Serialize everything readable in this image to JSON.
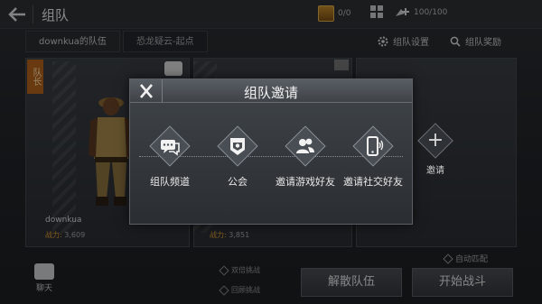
{
  "header": {
    "title": "组队",
    "chest_count": "0/0",
    "energy": "100/100"
  },
  "subbar": {
    "team_name": "downkua的队伍",
    "map_name": "恐龙疑云-起点",
    "settings_label": "组队设置",
    "rewards_label": "组队奖励"
  },
  "members": [
    {
      "badge": "队长",
      "name": "downkua",
      "power_label": "战力:",
      "power": "3,609"
    },
    {
      "power_label": "战力:",
      "power": "3,851"
    }
  ],
  "bottom": {
    "chat_label": "聊天",
    "option1": "双倍挑战",
    "option2": "回顾挑战",
    "auto_match": "自动匹配",
    "dissolve_label": "解散队伍",
    "start_label": "开始战斗"
  },
  "modal": {
    "title": "组队邀请",
    "options": [
      {
        "label": "组队频道",
        "icon": "chat-bubbles-icon"
      },
      {
        "label": "公会",
        "icon": "guild-banner-icon"
      },
      {
        "label": "邀请游戏好友",
        "icon": "friends-icon"
      },
      {
        "label": "邀请社交好友",
        "icon": "phone-icon"
      }
    ]
  },
  "invite": {
    "label": "邀请",
    "icon": "plus-icon"
  }
}
